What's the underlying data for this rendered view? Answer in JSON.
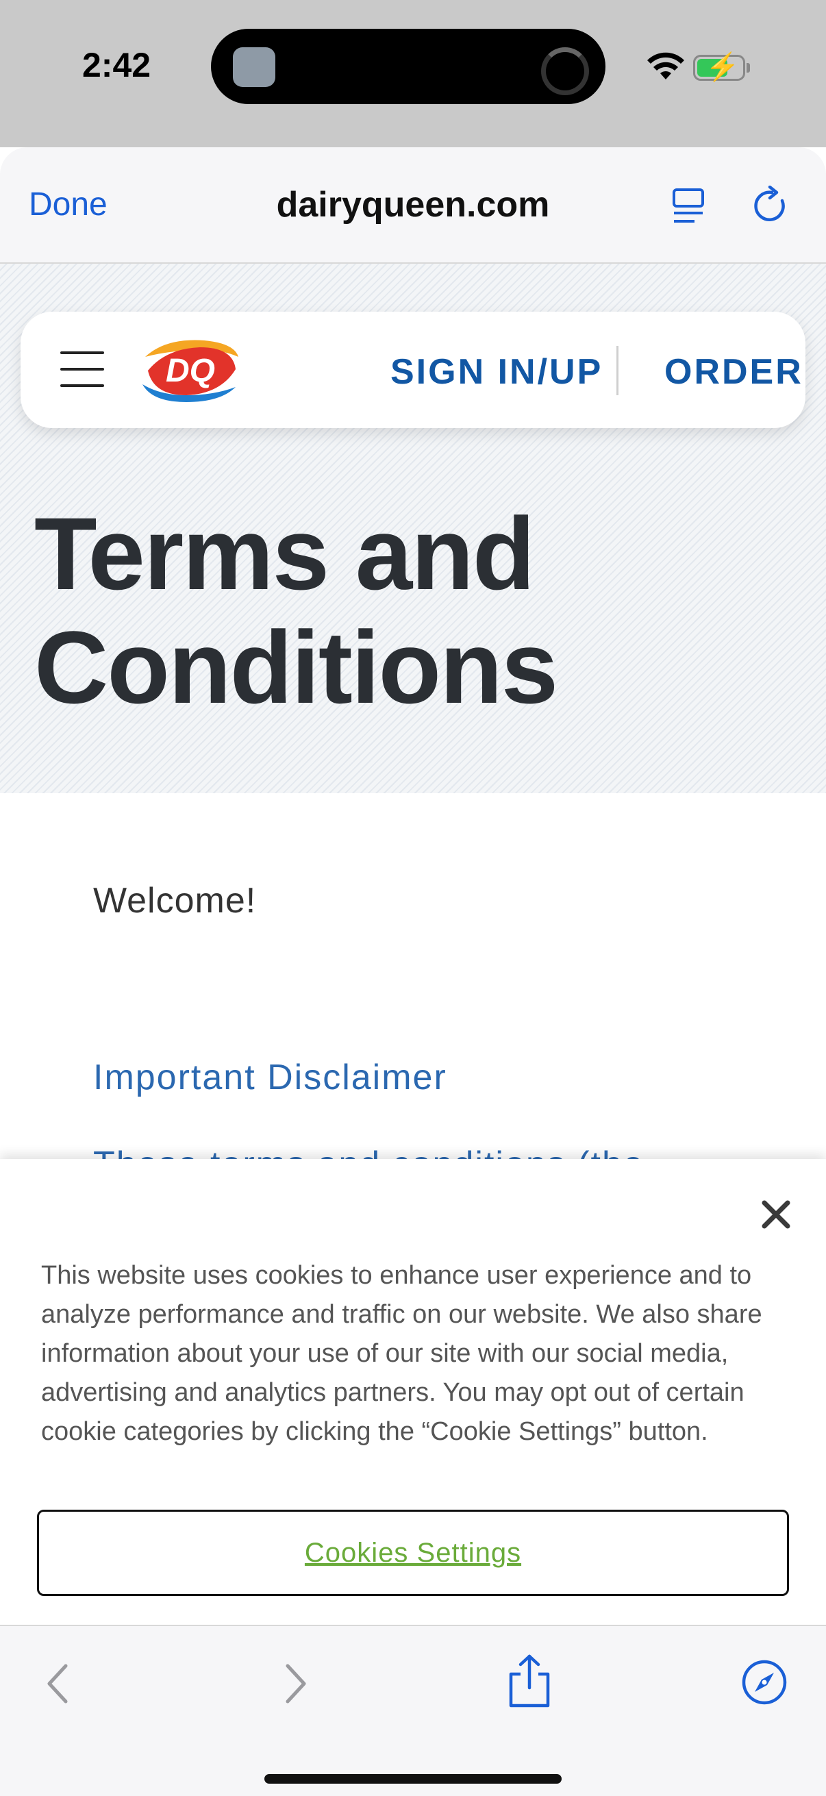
{
  "status_bar": {
    "time": "2:42"
  },
  "browser": {
    "done_label": "Done",
    "url": "dairyqueen.com"
  },
  "site_nav": {
    "logo_text": "DQ",
    "sign_in_label": "SIGN IN/UP",
    "order_label": "ORDER"
  },
  "page": {
    "title_line1": "Terms and",
    "title_line2": "Conditions",
    "welcome": "Welcome!",
    "disclaimer_heading": "Important Disclaimer",
    "cut_off_text": "These terms and conditions (the"
  },
  "cookie_banner": {
    "message": "This website uses cookies to enhance user experience and to analyze performance and traffic on our website. We also share information about your use of our site with our social media, advertising and analytics partners. You may opt out of certain cookie categories by clicking the “Cookie Settings” button.",
    "settings_button": "Cookies Settings"
  },
  "colors": {
    "accent_blue": "#1257a4",
    "ios_blue": "#1a5fd6",
    "cookie_link_green": "#6aab3a",
    "title_dark": "#2b2f34"
  }
}
